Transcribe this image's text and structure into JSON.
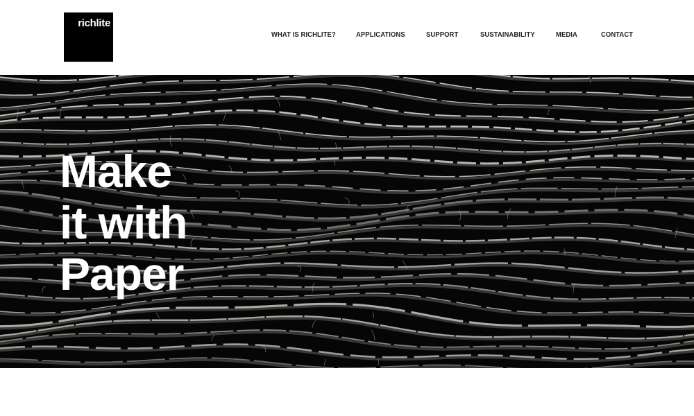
{
  "brand": {
    "logo_text": "richlite"
  },
  "nav": {
    "items": [
      {
        "label": "WHAT IS RICHLITE?"
      },
      {
        "label": "APPLICATIONS"
      },
      {
        "label": "SUPPORT"
      },
      {
        "label": "SUSTAINABILITY"
      },
      {
        "label": "MEDIA"
      },
      {
        "label": "CONTACT"
      }
    ]
  },
  "hero": {
    "headline_lines": [
      "Make",
      "it with",
      "Paper"
    ],
    "background_color": "#060606",
    "text_color": "#ffffff"
  }
}
